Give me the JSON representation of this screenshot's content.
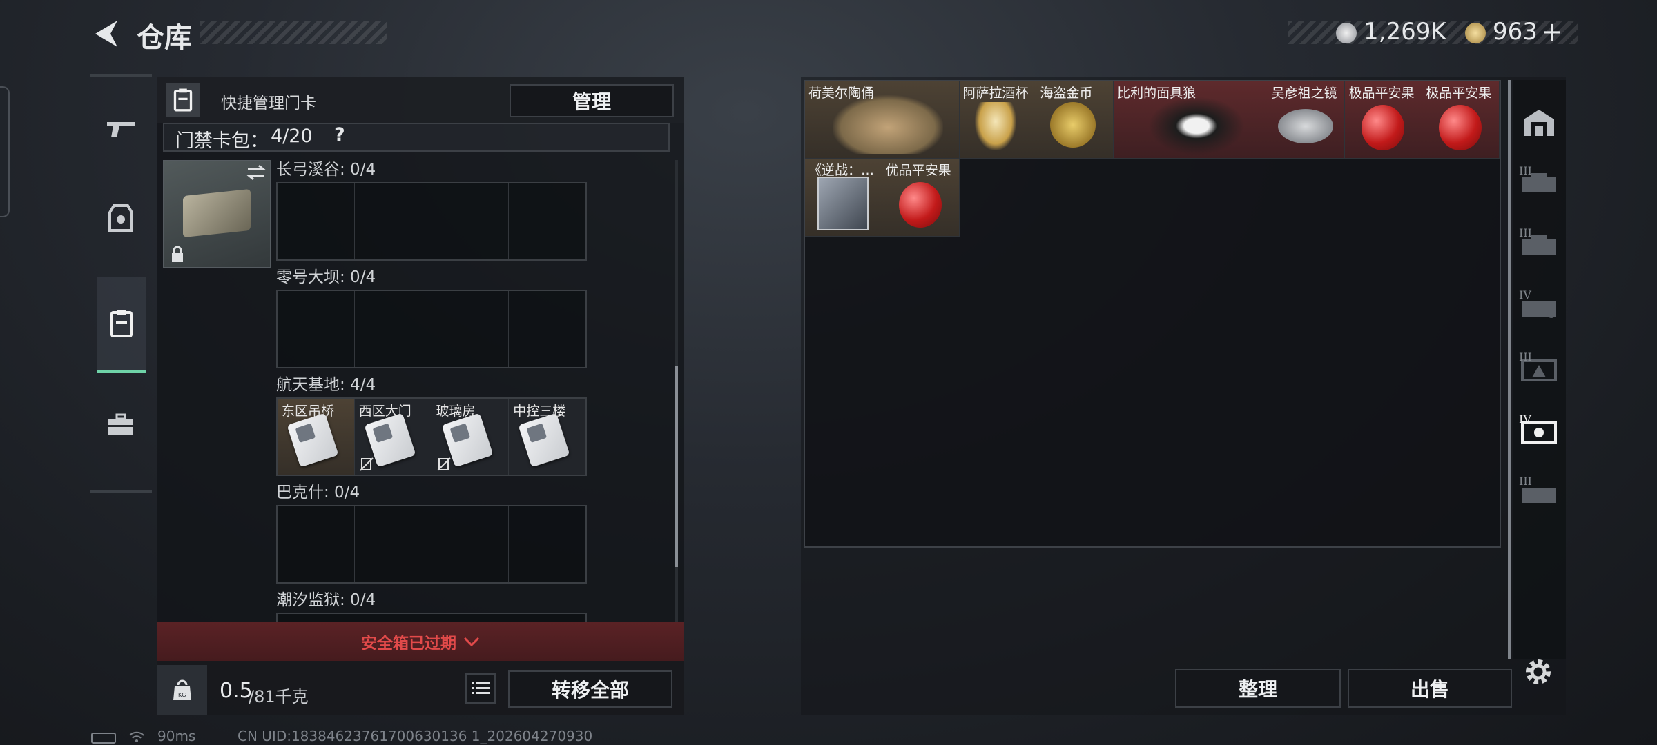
{
  "header": {
    "title": "仓库"
  },
  "currency": {
    "silver": "1,269K",
    "gold": "963",
    "add": "+"
  },
  "left_panel": {
    "quick_manage_label": "快捷管理门卡",
    "manage_button": "管理",
    "cardpack": {
      "label": "门禁卡包：",
      "count": "4/20",
      "help": "?"
    },
    "sections": [
      {
        "name": "长弓溪谷: 0/4",
        "slots": [
          "",
          "",
          "",
          ""
        ]
      },
      {
        "name": "零号大坝: 0/4",
        "slots": [
          "",
          "",
          "",
          ""
        ]
      },
      {
        "name": "航天基地: 4/4",
        "slots": [
          "东区吊桥",
          "西区大门",
          "玻璃房",
          "中控三楼"
        ]
      },
      {
        "name": "巴克什: 0/4",
        "slots": [
          "",
          "",
          "",
          ""
        ]
      },
      {
        "name": "潮汐监狱: 0/4",
        "slots": [
          "",
          "",
          "",
          ""
        ]
      }
    ],
    "expired_text": "安全箱已过期",
    "weight": {
      "current": "0.5",
      "max": "/81千克"
    },
    "transfer_all_button": "转移全部"
  },
  "stash": {
    "items": [
      {
        "name": "荷美尔陶俑",
        "rarity": "gold"
      },
      {
        "name": "阿萨拉酒杯",
        "rarity": "gold"
      },
      {
        "name": "海盗金币",
        "rarity": "gold"
      },
      {
        "name": "比利的面具狼",
        "rarity": "red"
      },
      {
        "name": "吴彦祖之镜",
        "rarity": "red"
      },
      {
        "name": "极品平安果",
        "rarity": "red"
      },
      {
        "name": "极品平安果",
        "rarity": "red"
      },
      {
        "name": "《逆战：…",
        "rarity": "gold"
      },
      {
        "name": "优品平安果",
        "rarity": "gold"
      }
    ],
    "sort_button": "整理",
    "sell_button": "出售"
  },
  "right_tabs": [
    "III",
    "III",
    "IV",
    "III",
    "IV",
    "III"
  ],
  "status_bar": {
    "ping": "90ms",
    "uid": "CN UID:18384623761700630136 1_202604270930"
  },
  "colors": {
    "expired": "#e24a4a",
    "nav_active": "#6fd3a8",
    "red_rarity": "#5e2a2c",
    "gold_rarity": "#4d4234"
  }
}
